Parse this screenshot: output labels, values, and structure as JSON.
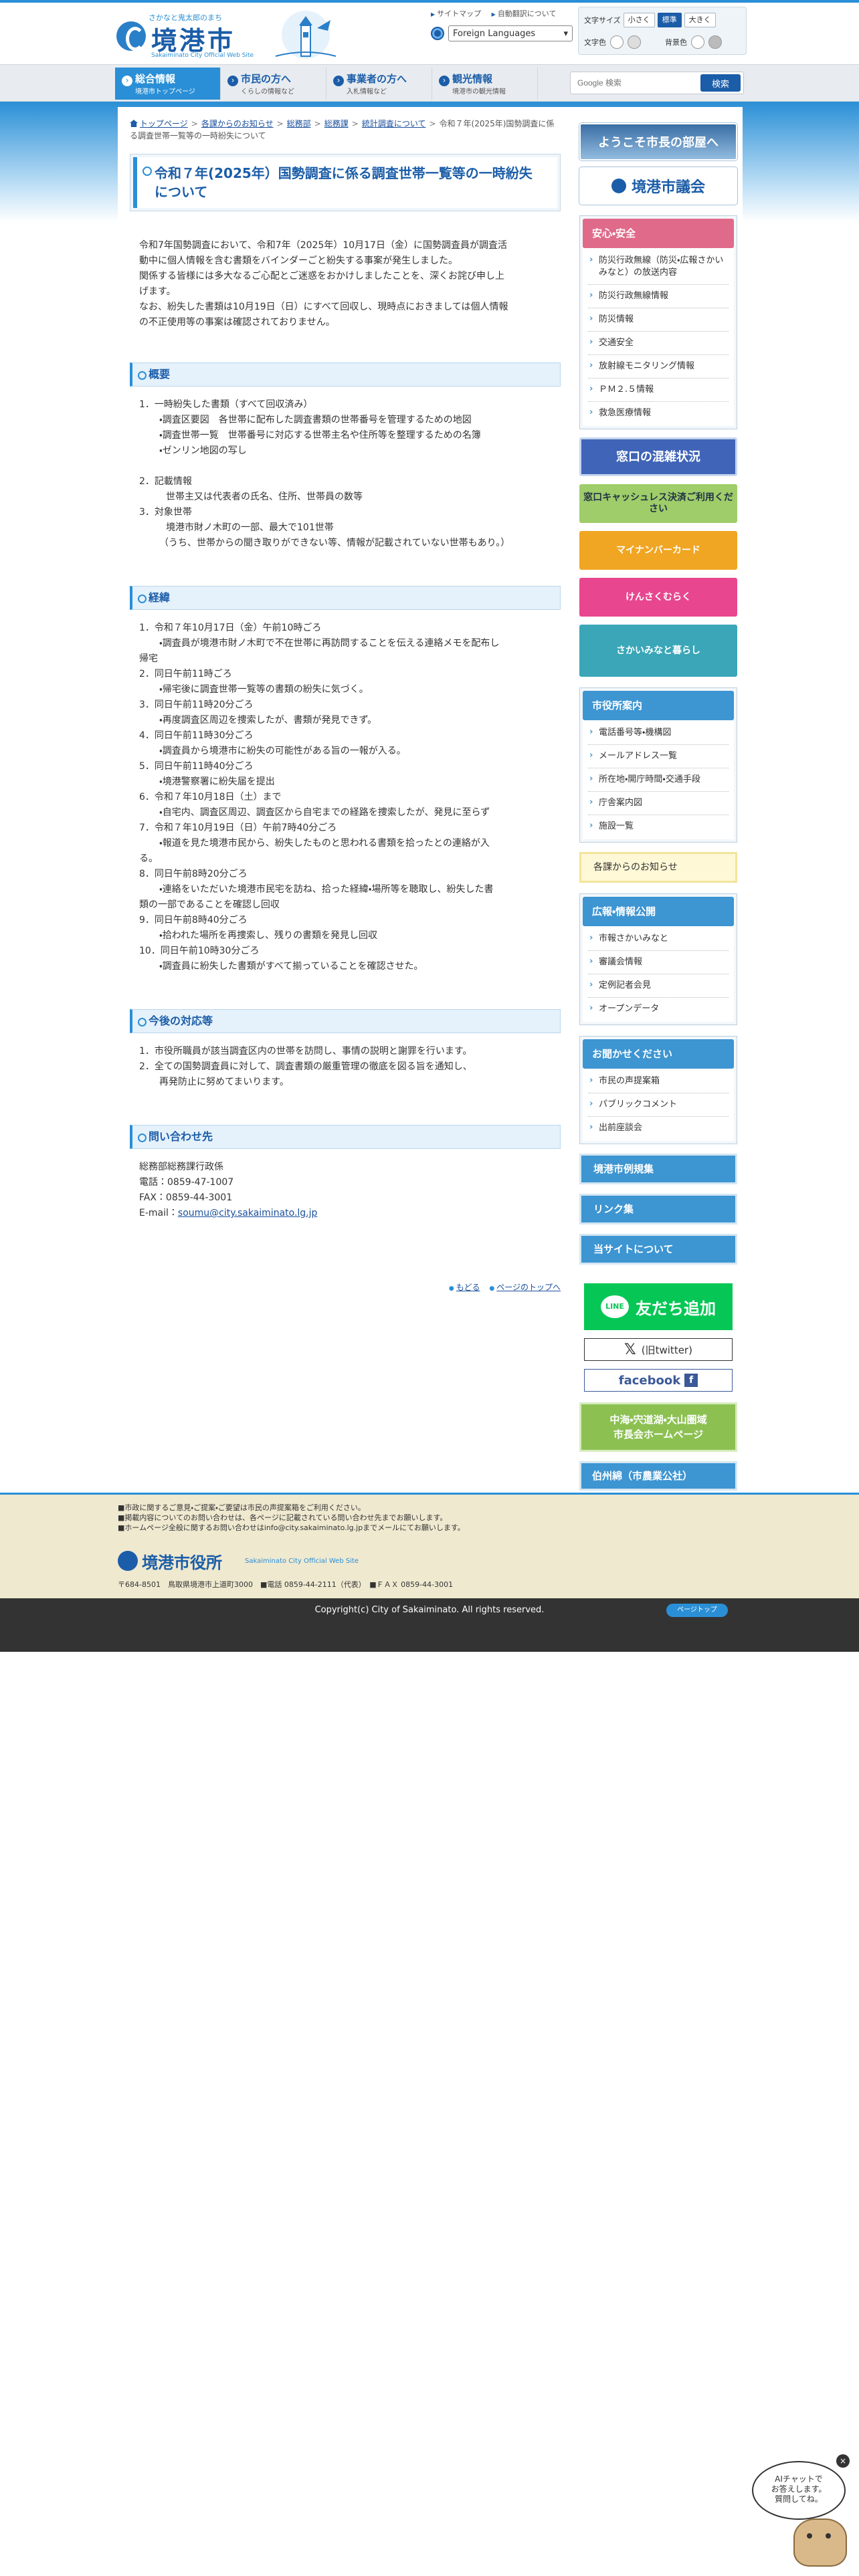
{
  "header": {
    "logo_tagline": "さかなと鬼太郎のまち",
    "logo_title": "境港市",
    "logo_sub": "Sakaiminato City Official Web Site",
    "utility_links": [
      "サイトマップ",
      "自動翻訳について"
    ],
    "language_select": "Foreign Languages",
    "text_size_label": "文字サイズ",
    "text_size_options": [
      "小さく",
      "標準",
      "大きく"
    ],
    "text_color_label": "文字色",
    "bg_color_label": "背景色"
  },
  "nav": {
    "items": [
      {
        "label": "総合情報",
        "sub": "境港市トップページ"
      },
      {
        "label": "市民の方へ",
        "sub": "くらしの情報など"
      },
      {
        "label": "事業者の方へ",
        "sub": "入札情報など"
      },
      {
        "label": "観光情報",
        "sub": "境港市の観光情報"
      }
    ],
    "search_placeholder": "Google 検索",
    "search_button": "検索"
  },
  "breadcrumb": {
    "items": [
      "トップページ",
      "各課からのお知らせ",
      "総務部",
      "総務課",
      "統計調査について"
    ],
    "current": "令和７年(2025年)国勢調査に係る調査世帯一覧等の一時紛失について"
  },
  "page": {
    "title": "令和７年(2025年）国勢調査に係る調査世帯一覧等の一時紛失について",
    "intro": [
      "令和7年国勢調査において、令和7年（2025年）10月17日（金）に国勢調査員が調査活",
      "動中に個人情報を含む書類をバインダーごと紛失する事案が発生しました。",
      "関係する皆様には多大なるご心配とご迷惑をおかけしましたことを、深くお詫び申し上",
      "げます。",
      "なお、紛失した書類は10月19日（日）にすべて回収し、現時点におきましては個人情報",
      "の不正使用等の事案は確認されておりません。"
    ]
  },
  "sections": {
    "overview": {
      "heading": "概要",
      "lines": [
        {
          "level": 1,
          "text": "1．一時紛失した書類（すべて回収済み）"
        },
        {
          "level": 2,
          "text": "・調査区要図　各世帯に配布した調査書類の世帯番号を管理するための地図"
        },
        {
          "level": 2,
          "text": "・調査世帯一覧　世帯番号に対応する世帯主名や住所等を整理するための名簿"
        },
        {
          "level": 2,
          "text": "・ゼンリン地図の写し"
        },
        {
          "level": 1,
          "text": ""
        },
        {
          "level": 1,
          "text": "2．記載情報"
        },
        {
          "level": 3,
          "text": "世帯主又は代表者の氏名、住所、世帯員の数等"
        },
        {
          "level": 1,
          "text": "3．対象世帯"
        },
        {
          "level": 3,
          "text": "境港市財ノ木町の一部、最大で101世帯"
        },
        {
          "level": 2,
          "text": "（うち、世帯からの聞き取りができない等、情報が記載されていない世帯もあり。）"
        }
      ]
    },
    "timeline": {
      "heading": "経緯",
      "lines": [
        {
          "level": 1,
          "text": "1．令和７年10月17日（金）午前10時ごろ"
        },
        {
          "level": 2,
          "text": "・調査員が境港市財ノ木町で不在世帯に再訪問することを伝える連絡メモを配布し"
        },
        {
          "level": 1,
          "text": "帰宅"
        },
        {
          "level": 1,
          "text": "2．同日午前11時ごろ"
        },
        {
          "level": 2,
          "text": "・帰宅後に調査世帯一覧等の書類の紛失に気づく。"
        },
        {
          "level": 1,
          "text": "3．同日午前11時20分ごろ"
        },
        {
          "level": 2,
          "text": "・再度調査区周辺を捜索したが、書類が発見できず。"
        },
        {
          "level": 1,
          "text": "4．同日午前11時30分ごろ"
        },
        {
          "level": 2,
          "text": "・調査員から境港市に紛失の可能性がある旨の一報が入る。"
        },
        {
          "level": 1,
          "text": "5．同日午前11時40分ごろ"
        },
        {
          "level": 2,
          "text": "・境港警察署に紛失届を提出"
        },
        {
          "level": 1,
          "text": "6．令和７年10月18日（土）まで"
        },
        {
          "level": 2,
          "text": "・自宅内、調査区周辺、調査区から自宅までの経路を捜索したが、発見に至らず"
        },
        {
          "level": 1,
          "text": "7．令和７年10月19日（日）午前7時40分ごろ"
        },
        {
          "level": 2,
          "text": "・報道を見た境港市民から、紛失したものと思われる書類を拾ったとの連絡が入"
        },
        {
          "level": 1,
          "text": "る。"
        },
        {
          "level": 1,
          "text": "8．同日午前8時20分ごろ"
        },
        {
          "level": 2,
          "text": "・連絡をいただいた境港市民宅を訪ね、拾った経緯・場所等を聴取し、紛失した書"
        },
        {
          "level": 1,
          "text": "類の一部であることを確認し回収"
        },
        {
          "level": 1,
          "text": "9．同日午前8時40分ごろ"
        },
        {
          "level": 2,
          "text": "・拾われた場所を再捜索し、残りの書類を発見し回収"
        },
        {
          "level": 1,
          "text": "10．同日午前10時30分ごろ"
        },
        {
          "level": 2,
          "text": "・調査員に紛失した書類がすべて揃っていることを確認させた。"
        }
      ]
    },
    "response": {
      "heading": "今後の対応等",
      "lines": [
        {
          "level": 1,
          "text": "1．市役所職員が該当調査区内の世帯を訪問し、事情の説明と謝罪を行います。"
        },
        {
          "level": 1,
          "text": "2．全ての国勢調査員に対して、調査書類の厳重管理の徹底を図る旨を通知し、"
        },
        {
          "level": 2,
          "text": "再発防止に努めてまいります。"
        }
      ]
    },
    "contact": {
      "heading": "問い合わせ先",
      "dept": "総務部総務課行政係",
      "phone": "電話：0859-47-1007",
      "fax": "FAX：0859-44-3001",
      "email_label": "E-mail：",
      "email": "soumu@city.sakaiminato.lg.jp"
    }
  },
  "page_links": [
    "もどる",
    "ページのトップへ"
  ],
  "sidebar": {
    "mayor_banner": "ようこそ市長の部屋へ",
    "assembly_banner": "境港市議会",
    "safety": {
      "heading": "安心・安全",
      "items": [
        "防災行政無線（防災・広報さかいみなと）の放送内容",
        "防災行政無線情報",
        "防災情報",
        "交通安全",
        "放射線モニタリング情報",
        "ＰＭ２.５情報",
        "救急医療情報"
      ]
    },
    "banners": {
      "konzatsu": "窓口の混雑状況",
      "cashless": "窓口キャッシュレス決済ご利用ください",
      "mynumber": "マイナンバーカード",
      "ijyu": "けんさくむらく",
      "kurashi": "さかいみなと暮らし"
    },
    "shiyakusho": {
      "heading": "市役所案内",
      "items": [
        "電話番号等・機構図",
        "メールアドレス一覧",
        "所在地・開庁時間・交通手段",
        "庁舎案内図",
        "施設一覧"
      ]
    },
    "kakuka": "各課からのお知らせ",
    "koho": {
      "heading": "広報・情報公開",
      "items": [
        "市報さかいみなと",
        "審議会情報",
        "定例記者会見",
        "オープンデータ"
      ]
    },
    "voice": {
      "heading": "お聞かせください",
      "items": [
        "市民の声提案箱",
        "パブリックコメント",
        "出前座談会"
      ]
    },
    "reiki": "境港市例規集",
    "links": "リンク集",
    "about": "当サイトについて",
    "line": "友だち追加",
    "line_icon": "LINE",
    "x": "(旧twitter)",
    "facebook": "facebook",
    "green_banner_lines": [
      "中海・宍道湖・大山圏域",
      "市長会ホームページ"
    ],
    "hakushu": "伯州綿（市農業公社）"
  },
  "footer": {
    "notes": [
      "■市政に関するご意見・ご提案・ご要望は市民の声提案箱をご利用ください。",
      "■掲載内容についてのお問い合わせは、各ページに記載されている問い合わせ先までお願いします。",
      "■ホームページ全般に関するお問い合わせはinfo@city.sakaiminato.lg.jpまでメールにてお願いします。"
    ],
    "logo": "境港市役所",
    "logo_sub": "Sakaiminato City Official Web Site",
    "address": "〒684-8501　鳥取県境港市上道町3000　■電話 0859-44-2111（代表）　■ＦＡＸ 0859-44-3001",
    "copyright": "Copyright(c) City of Sakaiminato. All rights reserved.",
    "pagetop": "ページトップ"
  },
  "ai_chat": {
    "lines": [
      "AIチャットで",
      "お答えします。",
      "質問してね。"
    ],
    "close": "×"
  }
}
